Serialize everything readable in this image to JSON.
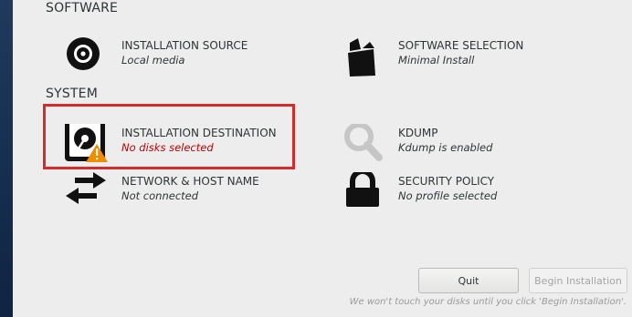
{
  "sections": {
    "software": "SOFTWARE",
    "system": "SYSTEM"
  },
  "spokes": {
    "installation_source": {
      "title": "INSTALLATION SOURCE",
      "status": "Local media",
      "icon": "disc-icon"
    },
    "software_selection": {
      "title": "SOFTWARE SELECTION",
      "status": "Minimal Install",
      "icon": "package-icon"
    },
    "installation_destination": {
      "title": "INSTALLATION DESTINATION",
      "status": "No disks selected",
      "icon": "hard-drive-warning-icon"
    },
    "kdump": {
      "title": "KDUMP",
      "status": "Kdump is enabled",
      "icon": "magnifier-icon"
    },
    "network": {
      "title": "NETWORK & HOST NAME",
      "status": "Not connected",
      "icon": "network-arrows-icon"
    },
    "security_policy": {
      "title": "SECURITY POLICY",
      "status": "No profile selected",
      "icon": "lock-icon"
    }
  },
  "buttons": {
    "quit": "Quit",
    "begin": "Begin Installation"
  },
  "hint": "We won't touch your disks until you click 'Begin Installation'.",
  "colors": {
    "warning_border": "#d62b2b",
    "warning_text": "#c00000",
    "warning_badge": "#f08c00",
    "background": "#ededed"
  }
}
